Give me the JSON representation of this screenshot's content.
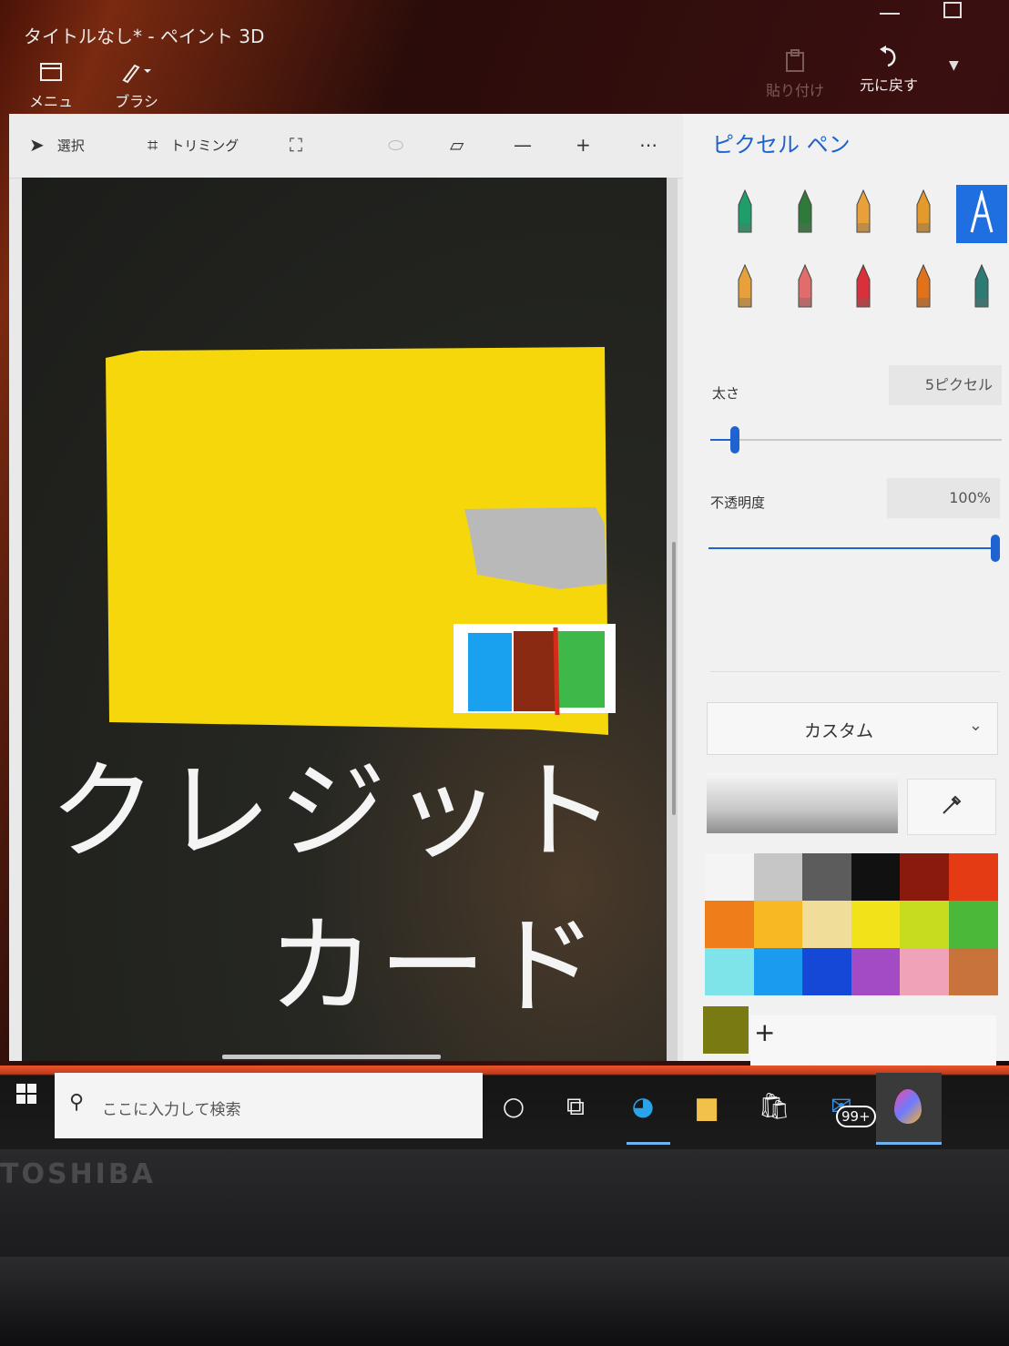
{
  "window": {
    "title": "タイトルなし* - ペイント 3D"
  },
  "titlebar": {
    "menu_label": "メニュー",
    "brush_label": "ブラシ",
    "paste_label": "貼り付け",
    "undo_label": "元に戻す"
  },
  "toolbar": {
    "select_label": "選択",
    "crop_label": "トリミング"
  },
  "panel": {
    "title": "ピクセル ペン",
    "thickness_label": "太さ",
    "thickness_value": "5ピクセル",
    "thickness_level": 0.07,
    "opacity_label": "不透明度",
    "opacity_value": "100%",
    "opacity_level": 1.0,
    "palette_dropdown": "カスタム",
    "selected_brush": "pixel-pen",
    "brushes": [
      {
        "name": "marker",
        "color": "#1e9e6a"
      },
      {
        "name": "calligraphy-pen",
        "color": "#2f7a3a"
      },
      {
        "name": "oil-brush",
        "color": "#e8a13a"
      },
      {
        "name": "watercolor",
        "color": "#e39a2b"
      },
      {
        "name": "pixel-pen",
        "color": "#ffffff"
      },
      {
        "name": "pencil",
        "color": "#e8a13a"
      },
      {
        "name": "eraser",
        "color": "#e06c6c"
      },
      {
        "name": "crayon",
        "color": "#d9313a"
      },
      {
        "name": "spray-can",
        "color": "#e0721c"
      },
      {
        "name": "fill",
        "color": "#2d7a74"
      }
    ],
    "swatches": [
      "#f4f4f4",
      "#c6c6c6",
      "#5c5c5c",
      "#111111",
      "#8b1a0e",
      "#e53b14",
      "#ef7d1a",
      "#f7b821",
      "#f1dd9a",
      "#f2e21a",
      "#c7db1f",
      "#4cb83a",
      "#7fe3ea",
      "#1b9bf0",
      "#1548d6",
      "#a34bc4",
      "#f0a3b8",
      "#c8733c"
    ],
    "current_color": "#7a7a12",
    "add_symbol": "+"
  },
  "canvas": {
    "text_line1": "クレジット",
    "text_line2": "カード"
  },
  "taskbar": {
    "search_placeholder": "ここに入力して検索",
    "mail_badge": "99+"
  },
  "device": {
    "brand": "TOSHIBA"
  }
}
